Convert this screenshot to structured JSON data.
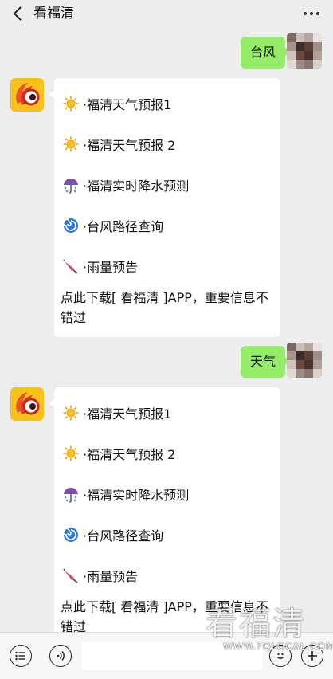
{
  "header": {
    "title": "看福清",
    "back_icon": "chevron-left-icon",
    "more_icon": "more-dots-icon"
  },
  "messages": [
    {
      "from": "me",
      "text": "台风"
    },
    {
      "from": "bot",
      "items": [
        {
          "icon": "sun-icon",
          "label": "·福清天气预报1"
        },
        {
          "icon": "sun-icon",
          "label": "·福清天气预报 2"
        },
        {
          "icon": "umbrella-rain-icon",
          "label": "·福清实时降水预测"
        },
        {
          "icon": "cyclone-icon",
          "label": "·台风路径查询"
        },
        {
          "icon": "closed-umbrella-icon",
          "label": "·雨量预告"
        }
      ],
      "promo": "点此下载[ 看福清 ]APP，重要信息不错过"
    },
    {
      "from": "me",
      "text": "天气"
    },
    {
      "from": "bot",
      "items": [
        {
          "icon": "sun-icon",
          "label": "·福清天气预报1"
        },
        {
          "icon": "sun-icon",
          "label": "·福清天气预报 2"
        },
        {
          "icon": "umbrella-rain-icon",
          "label": "·福清实时降水预测"
        },
        {
          "icon": "cyclone-icon",
          "label": "·台风路径查询"
        },
        {
          "icon": "closed-umbrella-icon",
          "label": "·雨量预告"
        }
      ],
      "promo": "点此下载[ 看福清 ]APP，重要信息不错过"
    }
  ],
  "input_bar": {
    "menu_icon": "menu-list-icon",
    "voice_icon": "voice-icon",
    "emoji_icon": "emoji-icon",
    "plus_icon": "plus-icon"
  },
  "watermark": {
    "text": "看福清",
    "url": "WWW.FQLOCAL.COM"
  },
  "colors": {
    "my_bubble": "#95ec69",
    "background": "#ededed",
    "bot_avatar": "#f6c21a"
  }
}
